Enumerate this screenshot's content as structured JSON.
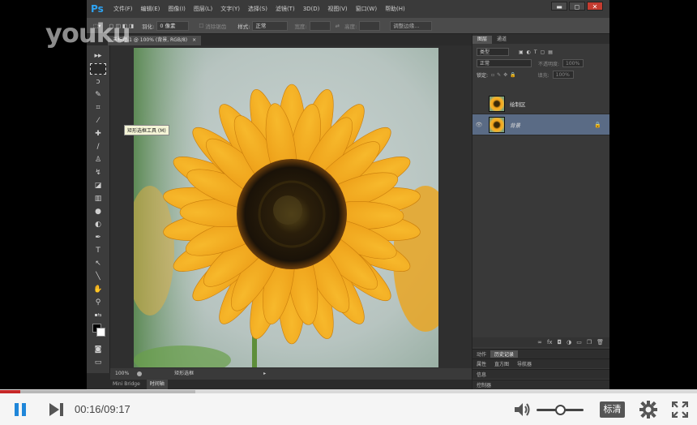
{
  "watermark": "youku",
  "app": {
    "logo": "Ps",
    "menu": [
      "文件(F)",
      "编辑(E)",
      "图像(I)",
      "图层(L)",
      "文字(Y)",
      "选择(S)",
      "滤镜(T)",
      "3D(D)",
      "视图(V)",
      "窗口(W)",
      "帮助(H)"
    ],
    "window_buttons": [
      "▬",
      "◻",
      "✕"
    ]
  },
  "options_bar": {
    "feather_label": "羽化:",
    "feather_value": "0 像素",
    "antialias_label": "消除锯齿",
    "style_label": "样式:",
    "style_value": "正常",
    "width_label": "宽度:",
    "height_label": "高度:",
    "refine_button": "调整边缘..."
  },
  "document_tab": "未标题-1 @ 100% (背景, RGB/8)",
  "tooltip": "矩形选框工具 (M)",
  "status": {
    "zoom": "100%",
    "doc_info": "矩形选框"
  },
  "bottom_tabs": [
    "Mini Bridge",
    "时间轴"
  ],
  "panels": {
    "tabs": [
      "图层",
      "通道"
    ],
    "filter_value": "类型",
    "blend_mode": "正常",
    "opacity_label": "不透明度:",
    "opacity_value": "100%",
    "lock_label": "锁定:",
    "fill_label": "填充:",
    "fill_value": "100%",
    "layers": [
      {
        "name": "绘制区",
        "visible": false,
        "selected": false,
        "locked": false
      },
      {
        "name": "背景",
        "visible": true,
        "selected": true,
        "locked": true
      }
    ],
    "history_tabs": [
      "动作",
      "历史记录"
    ],
    "properties_tabs": [
      "属性",
      "直方图",
      "导航器"
    ],
    "info_tab": "信息",
    "bottom_tab": "控制器"
  },
  "player": {
    "current_time": "00:16",
    "duration": "09:17",
    "time_text": "00:16/09:17",
    "progress": 0.029,
    "buffered": 0.28,
    "volume": 0.5,
    "quality": "标清",
    "accent_color": "#c62828"
  }
}
